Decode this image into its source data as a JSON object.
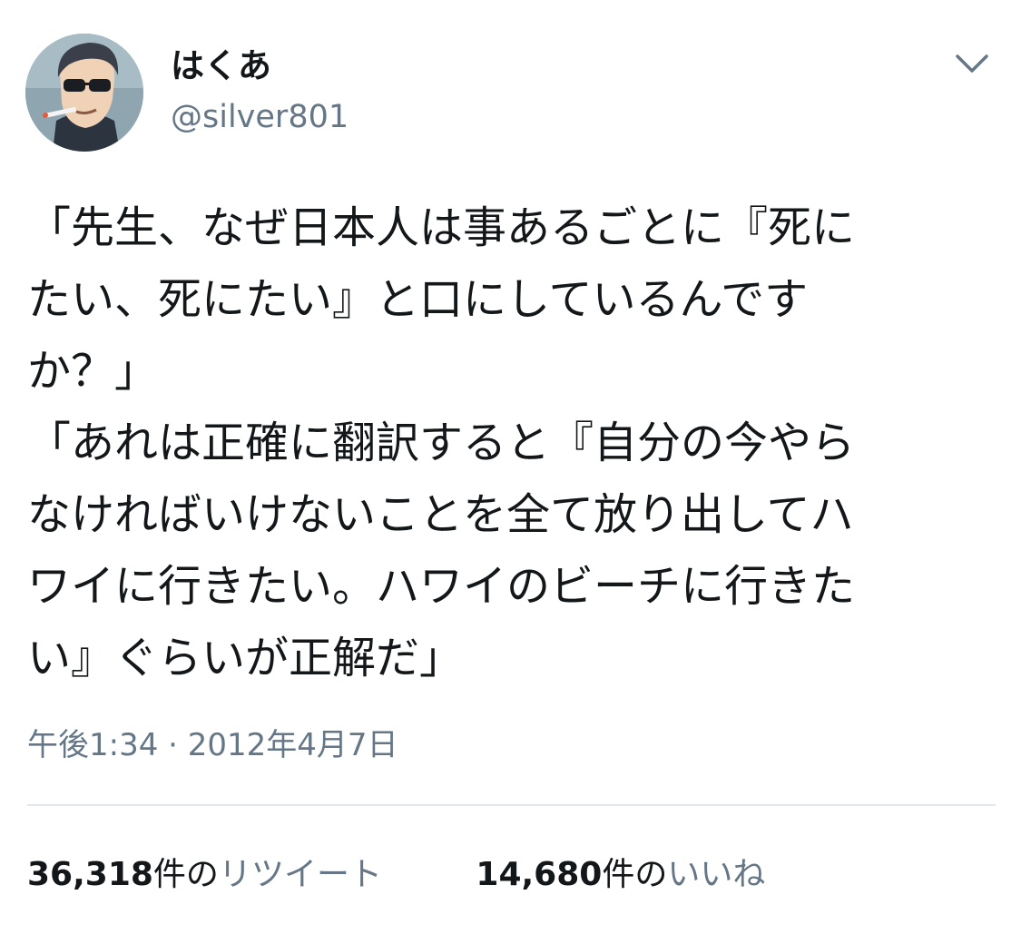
{
  "user": {
    "display_name": "はくあ",
    "handle": "@silver801",
    "avatar_icon": "avatar-icon"
  },
  "header": {
    "menu_icon": "chevron-down-icon"
  },
  "tweet": {
    "lines": [
      "「先生、なぜ日本人は事あるごとに『死に",
      "たい、死にたい』と口にしているんです",
      "か？」",
      "「あれは正確に翻訳すると『自分の今やら",
      "なければいけないことを全て放り出してハ",
      "ワイに行きたい。ハワイのビーチに行きた",
      "い』ぐらいが正解だ」"
    ],
    "timestamp": "午後1:34 · 2012年4月7日"
  },
  "stats": {
    "retweets": {
      "count": "36,318",
      "suffix": "件の",
      "label": "リツイート"
    },
    "likes": {
      "count": "14,680",
      "suffix": "件の",
      "label": "いいね"
    }
  },
  "colors": {
    "text": "#14171a",
    "secondary_text": "#657786",
    "divider": "#e1e8ed"
  }
}
